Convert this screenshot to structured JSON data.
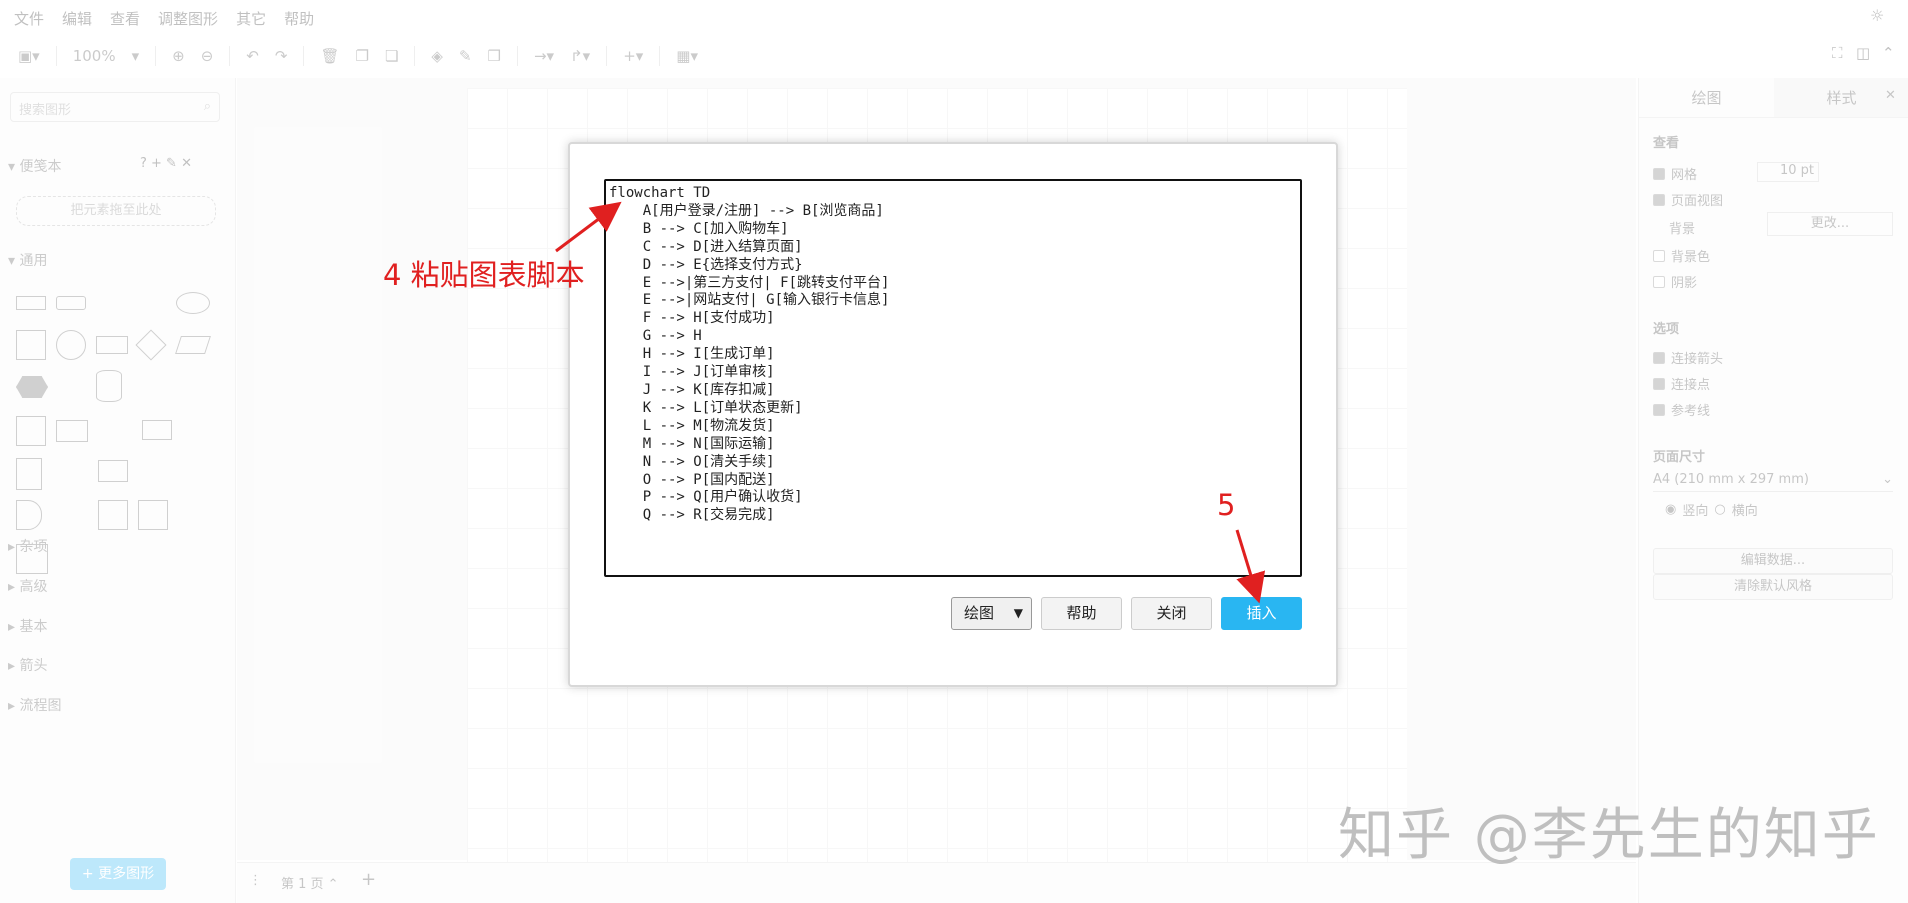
{
  "menubar": {
    "items": [
      "文件",
      "编辑",
      "查看",
      "调整图形",
      "其它",
      "帮助"
    ]
  },
  "toolbar": {
    "zoom": "100%"
  },
  "left_panel": {
    "search_placeholder": "搜索图形",
    "scratchpad_title": "便笺本",
    "drop_zone": "把元素拖至此处",
    "general_title": "通用",
    "sections": [
      "杂项",
      "高级",
      "基本",
      "箭头",
      "流程图"
    ],
    "more_shapes": "+ 更多图形"
  },
  "page_tabs": {
    "current": "第 1 页"
  },
  "right_panel": {
    "tabs": [
      "绘图",
      "样式"
    ],
    "view_title": "查看",
    "grid_label": "网格",
    "grid_size": "10 pt",
    "page_view_label": "页面视图",
    "background_label": "背景",
    "change_btn": "更改...",
    "bg_color_label": "背景色",
    "shadow_label": "阴影",
    "options_title": "选项",
    "connection_arrows": "连接箭头",
    "connection_points": "连接点",
    "guides": "参考线",
    "page_size_title": "页面尺寸",
    "page_size_value": "A4 (210 mm x 297 mm)",
    "portrait": "竖向",
    "landscape": "横向",
    "edit_data_btn": "编辑数据...",
    "clear_style_btn": "清除默认风格"
  },
  "dialog": {
    "script": "flowchart TD\n    A[用户登录/注册] --> B[浏览商品]\n    B --> C[加入购物车]\n    C --> D[进入结算页面]\n    D --> E{选择支付方式}\n    E -->|第三方支付| F[跳转支付平台]\n    E -->|网站支付| G[输入银行卡信息]\n    F --> H[支付成功]\n    G --> H\n    H --> I[生成订单]\n    I --> J[订单审核]\n    J --> K[库存扣减]\n    K --> L[订单状态更新]\n    L --> M[物流发货]\n    M --> N[国际运输]\n    N --> O[清关手续]\n    O --> P[国内配送]\n    P --> Q[用户确认收货]\n    Q --> R[交易完成]",
    "diagram_type": "绘图",
    "help_btn": "帮助",
    "close_btn": "关闭",
    "insert_btn": "插入"
  },
  "annotations": {
    "step4": "4 粘贴图表脚本",
    "step5": "5"
  },
  "watermark": "知乎 @李先生的知乎",
  "colors": {
    "accent": "#29b6f2",
    "annotation": "#e02020"
  }
}
